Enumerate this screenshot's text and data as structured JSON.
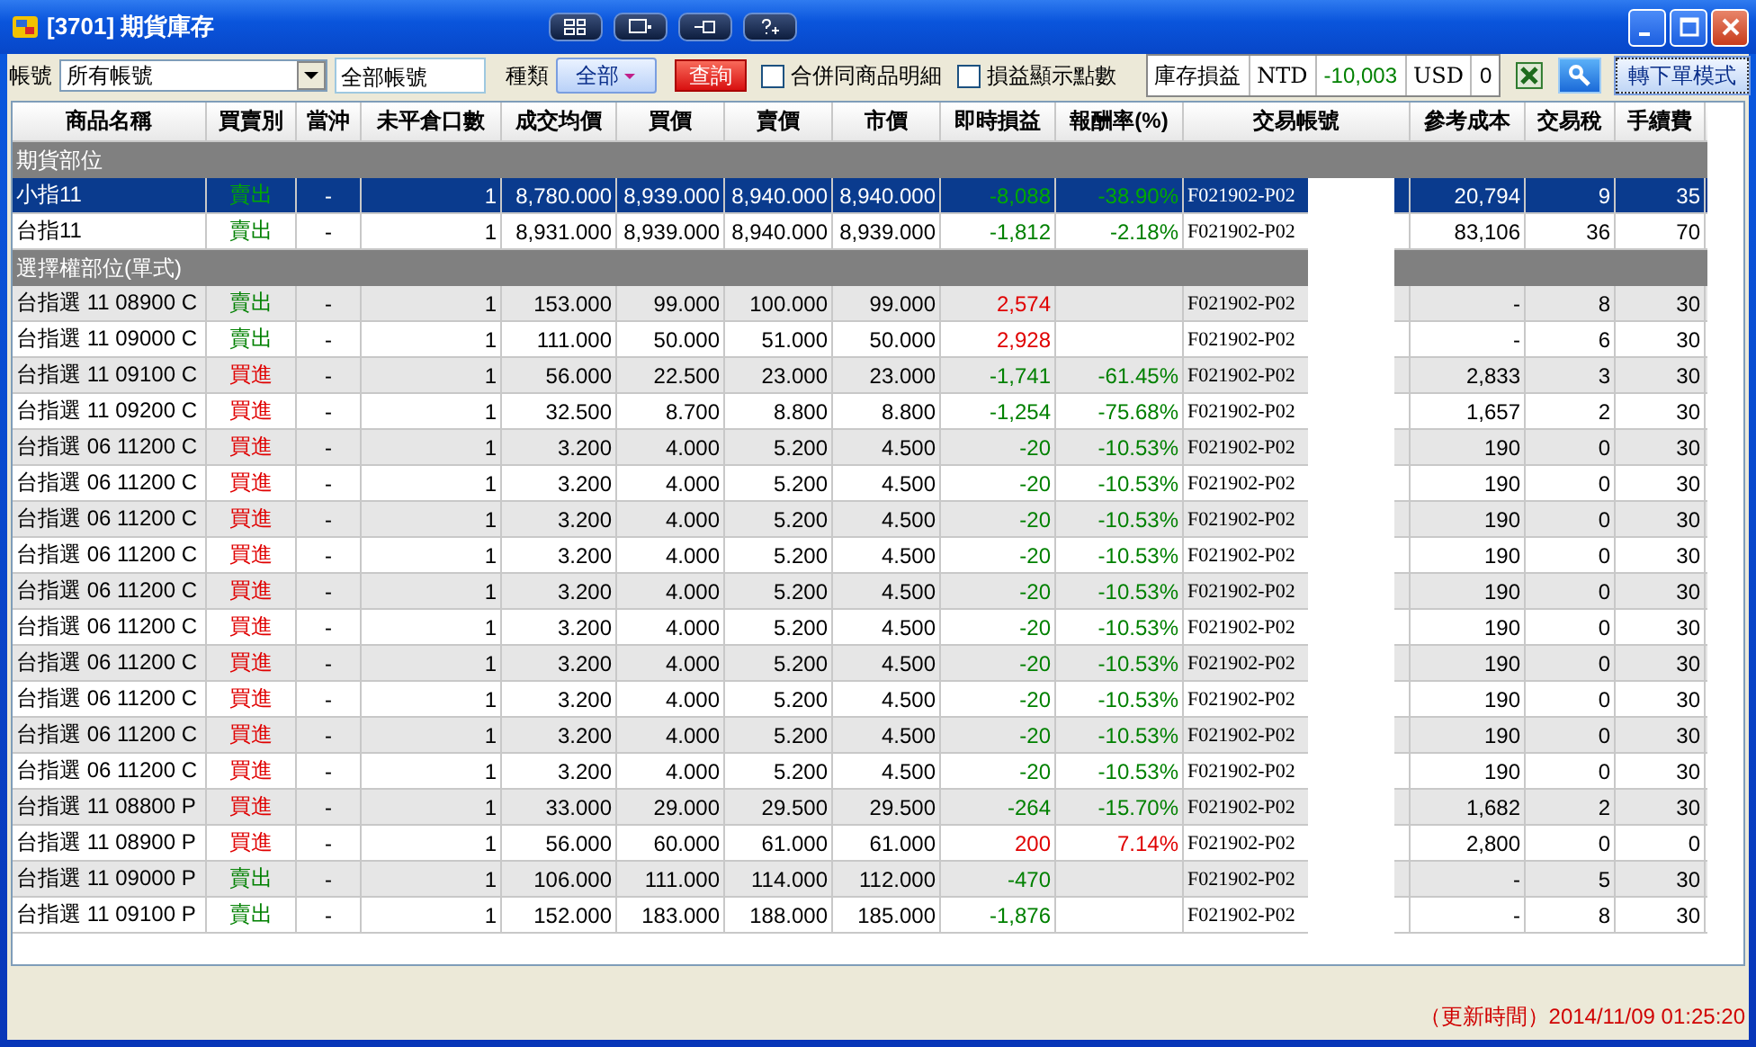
{
  "window": {
    "title": "[3701] 期貨庫存"
  },
  "toolbar": {
    "account_label": "帳號",
    "account_select": "所有帳號",
    "account_field": "全部帳號",
    "type_label": "種類",
    "type_button": "全部",
    "query_button": "查詢",
    "checkboxes": [
      {
        "label": "合併同商品明細",
        "checked": false
      },
      {
        "label": "損益顯示點數",
        "checked": false
      }
    ],
    "summary": {
      "label": "庫存損益",
      "currency_1": "NTD",
      "value_1": {
        "text": "-10,003",
        "color": "#008000"
      },
      "currency_2": "USD",
      "value_2": "0"
    },
    "mode_button": "轉下單模式"
  },
  "table": {
    "columns": [
      "商品名稱",
      "買賣別",
      "當沖",
      "未平倉口數",
      "成交均價",
      "買價",
      "賣價",
      "市價",
      "即時損益",
      "報酬率(%)",
      "交易帳號",
      "參考成本",
      "交易稅",
      "手續費"
    ],
    "sections": [
      {
        "title": "期貨部位",
        "rows": [
          {
            "selected": true,
            "name": "小指11",
            "side": {
              "text": "賣出",
              "color": "#00aa00"
            },
            "daytrade": "-",
            "open_qty": "1",
            "avg": "8,780.000",
            "bid": "8,939.000",
            "ask": "8,940.000",
            "market": "8,940.000",
            "pnl": {
              "text": "-8,088",
              "color": "#00aa00"
            },
            "rate": {
              "text": "-38.90%",
              "color": "#00aa00"
            },
            "account": "F021902-P02",
            "cost": "20,794",
            "tax": "9",
            "fee": "35"
          },
          {
            "selected": false,
            "name": "台指11",
            "side": {
              "text": "賣出",
              "color": "#008000"
            },
            "daytrade": "-",
            "open_qty": "1",
            "avg": "8,931.000",
            "bid": "8,939.000",
            "ask": "8,940.000",
            "market": "8,939.000",
            "pnl": {
              "text": "-1,812",
              "color": "#008000"
            },
            "rate": {
              "text": "-2.18%",
              "color": "#008000"
            },
            "account": "F021902-P02",
            "cost": "83,106",
            "tax": "36",
            "fee": "70"
          }
        ]
      },
      {
        "title": "選擇權部位(單式)",
        "rows": [
          {
            "selected": false,
            "name": "台指選 11 08900 C",
            "side": {
              "text": "賣出",
              "color": "#008000"
            },
            "daytrade": "-",
            "open_qty": "1",
            "avg": "153.000",
            "bid": "99.000",
            "ask": "100.000",
            "market": "99.000",
            "pnl": {
              "text": "2,574",
              "color": "#e00000"
            },
            "account": "F021902-P02",
            "cost": "-",
            "tax": "8",
            "fee": "30"
          },
          {
            "selected": false,
            "name": "台指選 11 09000 C",
            "side": {
              "text": "賣出",
              "color": "#008000"
            },
            "daytrade": "-",
            "open_qty": "1",
            "avg": "111.000",
            "bid": "50.000",
            "ask": "51.000",
            "market": "50.000",
            "pnl": {
              "text": "2,928",
              "color": "#e00000"
            },
            "account": "F021902-P02",
            "cost": "-",
            "tax": "6",
            "fee": "30"
          },
          {
            "selected": false,
            "name": "台指選 11 09100 C",
            "side": {
              "text": "買進",
              "color": "#e00000"
            },
            "daytrade": "-",
            "open_qty": "1",
            "avg": "56.000",
            "bid": "22.500",
            "ask": "23.000",
            "market": "23.000",
            "pnl": {
              "text": "-1,741",
              "color": "#008000"
            },
            "rate": {
              "text": "-61.45%",
              "color": "#008000"
            },
            "account": "F021902-P02",
            "cost": "2,833",
            "tax": "3",
            "fee": "30"
          },
          {
            "selected": false,
            "name": "台指選 11 09200 C",
            "side": {
              "text": "買進",
              "color": "#e00000"
            },
            "daytrade": "-",
            "open_qty": "1",
            "avg": "32.500",
            "bid": "8.700",
            "ask": "8.800",
            "market": "8.800",
            "pnl": {
              "text": "-1,254",
              "color": "#008000"
            },
            "rate": {
              "text": "-75.68%",
              "color": "#008000"
            },
            "account": "F021902-P02",
            "cost": "1,657",
            "tax": "2",
            "fee": "30"
          },
          {
            "selected": false,
            "name": "台指選 06 11200 C",
            "side": {
              "text": "買進",
              "color": "#e00000"
            },
            "daytrade": "-",
            "open_qty": "1",
            "avg": "3.200",
            "bid": "4.000",
            "ask": "5.200",
            "market": "4.500",
            "pnl": {
              "text": "-20",
              "color": "#008000"
            },
            "rate": {
              "text": "-10.53%",
              "color": "#008000"
            },
            "account": "F021902-P02",
            "cost": "190",
            "tax": "0",
            "fee": "30"
          },
          {
            "selected": false,
            "name": "台指選 06 11200 C",
            "side": {
              "text": "買進",
              "color": "#e00000"
            },
            "daytrade": "-",
            "open_qty": "1",
            "avg": "3.200",
            "bid": "4.000",
            "ask": "5.200",
            "market": "4.500",
            "pnl": {
              "text": "-20",
              "color": "#008000"
            },
            "rate": {
              "text": "-10.53%",
              "color": "#008000"
            },
            "account": "F021902-P02",
            "cost": "190",
            "tax": "0",
            "fee": "30"
          },
          {
            "selected": false,
            "name": "台指選 06 11200 C",
            "side": {
              "text": "買進",
              "color": "#e00000"
            },
            "daytrade": "-",
            "open_qty": "1",
            "avg": "3.200",
            "bid": "4.000",
            "ask": "5.200",
            "market": "4.500",
            "pnl": {
              "text": "-20",
              "color": "#008000"
            },
            "rate": {
              "text": "-10.53%",
              "color": "#008000"
            },
            "account": "F021902-P02",
            "cost": "190",
            "tax": "0",
            "fee": "30"
          },
          {
            "selected": false,
            "name": "台指選 06 11200 C",
            "side": {
              "text": "買進",
              "color": "#e00000"
            },
            "daytrade": "-",
            "open_qty": "1",
            "avg": "3.200",
            "bid": "4.000",
            "ask": "5.200",
            "market": "4.500",
            "pnl": {
              "text": "-20",
              "color": "#008000"
            },
            "rate": {
              "text": "-10.53%",
              "color": "#008000"
            },
            "account": "F021902-P02",
            "cost": "190",
            "tax": "0",
            "fee": "30"
          },
          {
            "selected": false,
            "name": "台指選 06 11200 C",
            "side": {
              "text": "買進",
              "color": "#e00000"
            },
            "daytrade": "-",
            "open_qty": "1",
            "avg": "3.200",
            "bid": "4.000",
            "ask": "5.200",
            "market": "4.500",
            "pnl": {
              "text": "-20",
              "color": "#008000"
            },
            "rate": {
              "text": "-10.53%",
              "color": "#008000"
            },
            "account": "F021902-P02",
            "cost": "190",
            "tax": "0",
            "fee": "30"
          },
          {
            "selected": false,
            "name": "台指選 06 11200 C",
            "side": {
              "text": "買進",
              "color": "#e00000"
            },
            "daytrade": "-",
            "open_qty": "1",
            "avg": "3.200",
            "bid": "4.000",
            "ask": "5.200",
            "market": "4.500",
            "pnl": {
              "text": "-20",
              "color": "#008000"
            },
            "rate": {
              "text": "-10.53%",
              "color": "#008000"
            },
            "account": "F021902-P02",
            "cost": "190",
            "tax": "0",
            "fee": "30"
          },
          {
            "selected": false,
            "name": "台指選 06 11200 C",
            "side": {
              "text": "買進",
              "color": "#e00000"
            },
            "daytrade": "-",
            "open_qty": "1",
            "avg": "3.200",
            "bid": "4.000",
            "ask": "5.200",
            "market": "4.500",
            "pnl": {
              "text": "-20",
              "color": "#008000"
            },
            "rate": {
              "text": "-10.53%",
              "color": "#008000"
            },
            "account": "F021902-P02",
            "cost": "190",
            "tax": "0",
            "fee": "30"
          },
          {
            "selected": false,
            "name": "台指選 06 11200 C",
            "side": {
              "text": "買進",
              "color": "#e00000"
            },
            "daytrade": "-",
            "open_qty": "1",
            "avg": "3.200",
            "bid": "4.000",
            "ask": "5.200",
            "market": "4.500",
            "pnl": {
              "text": "-20",
              "color": "#008000"
            },
            "rate": {
              "text": "-10.53%",
              "color": "#008000"
            },
            "account": "F021902-P02",
            "cost": "190",
            "tax": "0",
            "fee": "30"
          },
          {
            "selected": false,
            "name": "台指選 06 11200 C",
            "side": {
              "text": "買進",
              "color": "#e00000"
            },
            "daytrade": "-",
            "open_qty": "1",
            "avg": "3.200",
            "bid": "4.000",
            "ask": "5.200",
            "market": "4.500",
            "pnl": {
              "text": "-20",
              "color": "#008000"
            },
            "rate": {
              "text": "-10.53%",
              "color": "#008000"
            },
            "account": "F021902-P02",
            "cost": "190",
            "tax": "0",
            "fee": "30"
          },
          {
            "selected": false,
            "name": "台指選 06 11200 C",
            "side": {
              "text": "買進",
              "color": "#e00000"
            },
            "daytrade": "-",
            "open_qty": "1",
            "avg": "3.200",
            "bid": "4.000",
            "ask": "5.200",
            "market": "4.500",
            "pnl": {
              "text": "-20",
              "color": "#008000"
            },
            "rate": {
              "text": "-10.53%",
              "color": "#008000"
            },
            "account": "F021902-P02",
            "cost": "190",
            "tax": "0",
            "fee": "30"
          },
          {
            "selected": false,
            "name": "台指選 11 08800 P",
            "side": {
              "text": "買進",
              "color": "#e00000"
            },
            "daytrade": "-",
            "open_qty": "1",
            "avg": "33.000",
            "bid": "29.000",
            "ask": "29.500",
            "market": "29.500",
            "pnl": {
              "text": "-264",
              "color": "#008000"
            },
            "rate": {
              "text": "-15.70%",
              "color": "#008000"
            },
            "account": "F021902-P02",
            "cost": "1,682",
            "tax": "2",
            "fee": "30"
          },
          {
            "selected": false,
            "name": "台指選 11 08900 P",
            "side": {
              "text": "買進",
              "color": "#e00000"
            },
            "daytrade": "-",
            "open_qty": "1",
            "avg": "56.000",
            "bid": "60.000",
            "ask": "61.000",
            "market": "61.000",
            "pnl": {
              "text": "200",
              "color": "#e00000"
            },
            "rate": {
              "text": "7.14%",
              "color": "#e00000"
            },
            "account": "F021902-P02",
            "cost": "2,800",
            "tax": "0",
            "fee": "0"
          },
          {
            "selected": false,
            "name": "台指選 11 09000 P",
            "side": {
              "text": "賣出",
              "color": "#008000"
            },
            "daytrade": "-",
            "open_qty": "1",
            "avg": "106.000",
            "bid": "111.000",
            "ask": "114.000",
            "market": "112.000",
            "pnl": {
              "text": "-470",
              "color": "#008000"
            },
            "account": "F021902-P02",
            "cost": "-",
            "tax": "5",
            "fee": "30"
          },
          {
            "selected": false,
            "name": "台指選 11 09100 P",
            "side": {
              "text": "賣出",
              "color": "#008000"
            },
            "daytrade": "-",
            "open_qty": "1",
            "avg": "152.000",
            "bid": "183.000",
            "ask": "188.000",
            "market": "185.000",
            "pnl": {
              "text": "-1,876",
              "color": "#008000"
            },
            "account": "F021902-P02",
            "cost": "-",
            "tax": "8",
            "fee": "30"
          }
        ]
      }
    ]
  },
  "status_bar": {
    "update_time": "（更新時間）2014/11/09 01:25:20"
  }
}
